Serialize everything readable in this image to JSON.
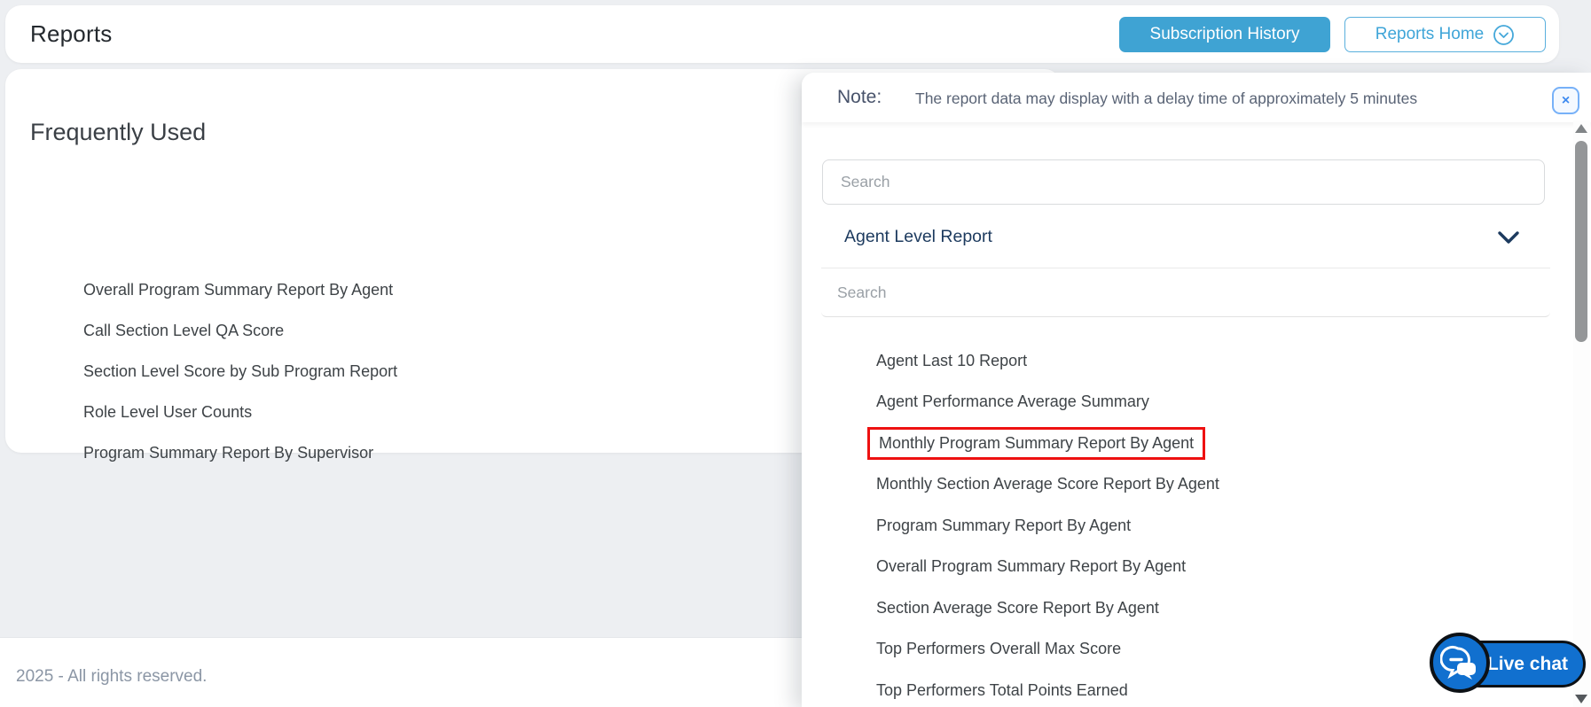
{
  "header": {
    "title": "Reports",
    "subscription_button": "Subscription History",
    "reports_home_button": "Reports Home"
  },
  "note": {
    "label": "Note:",
    "message": "The report data may display with a delay time of approximately 5 minutes",
    "close_glyph": "×"
  },
  "frequently_used": {
    "title": "Frequently Used",
    "items": [
      {
        "label": "Overall Program Summary Report By Agent"
      },
      {
        "label": "Call Section Level QA Score"
      },
      {
        "label": "Section Level Score by Sub Program Report"
      },
      {
        "label": "Role Level User Counts"
      },
      {
        "label": "Program Summary Report By Supervisor"
      }
    ]
  },
  "report_browser": {
    "search_placeholder": "Search",
    "category": {
      "label": "Agent Level Report"
    },
    "list_search_placeholder": "Search",
    "items": [
      {
        "label": "Agent Last 10 Report",
        "highlighted": false
      },
      {
        "label": "Agent Performance Average Summary",
        "highlighted": false
      },
      {
        "label": "Monthly Program Summary Report By Agent",
        "highlighted": true
      },
      {
        "label": "Monthly Section Average Score Report By Agent",
        "highlighted": false
      },
      {
        "label": "Program Summary Report By Agent",
        "highlighted": false
      },
      {
        "label": "Overall Program Summary Report By Agent",
        "highlighted": false
      },
      {
        "label": "Section Average Score Report By Agent",
        "highlighted": false
      },
      {
        "label": "Top Performers Overall Max Score",
        "highlighted": false
      },
      {
        "label": "Top Performers Total Points Earned",
        "highlighted": false
      }
    ]
  },
  "footer": {
    "copyright": "2025 - All rights reserved."
  },
  "live_chat": {
    "label": "Live chat"
  },
  "colors": {
    "accent_blue": "#3fa3d3",
    "navy": "#1c3a5e",
    "highlight_red": "#ee1111",
    "chat_blue": "#1170cf",
    "page_background": "#edeff2"
  }
}
